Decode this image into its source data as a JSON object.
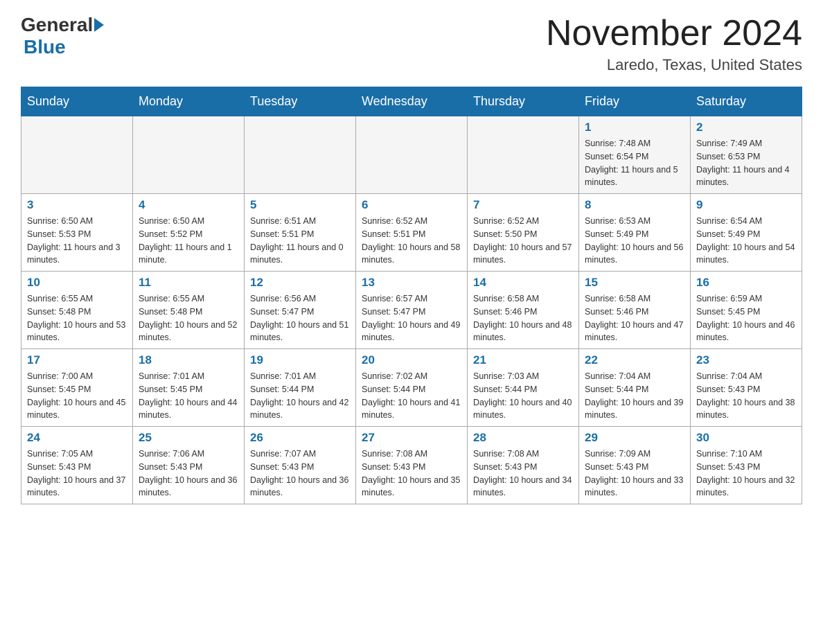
{
  "header": {
    "logo_general": "General",
    "logo_blue": "Blue",
    "month_title": "November 2024",
    "location": "Laredo, Texas, United States"
  },
  "weekdays": [
    "Sunday",
    "Monday",
    "Tuesday",
    "Wednesday",
    "Thursday",
    "Friday",
    "Saturday"
  ],
  "rows": [
    [
      {
        "day": "",
        "info": ""
      },
      {
        "day": "",
        "info": ""
      },
      {
        "day": "",
        "info": ""
      },
      {
        "day": "",
        "info": ""
      },
      {
        "day": "",
        "info": ""
      },
      {
        "day": "1",
        "info": "Sunrise: 7:48 AM\nSunset: 6:54 PM\nDaylight: 11 hours and 5 minutes."
      },
      {
        "day": "2",
        "info": "Sunrise: 7:49 AM\nSunset: 6:53 PM\nDaylight: 11 hours and 4 minutes."
      }
    ],
    [
      {
        "day": "3",
        "info": "Sunrise: 6:50 AM\nSunset: 5:53 PM\nDaylight: 11 hours and 3 minutes."
      },
      {
        "day": "4",
        "info": "Sunrise: 6:50 AM\nSunset: 5:52 PM\nDaylight: 11 hours and 1 minute."
      },
      {
        "day": "5",
        "info": "Sunrise: 6:51 AM\nSunset: 5:51 PM\nDaylight: 11 hours and 0 minutes."
      },
      {
        "day": "6",
        "info": "Sunrise: 6:52 AM\nSunset: 5:51 PM\nDaylight: 10 hours and 58 minutes."
      },
      {
        "day": "7",
        "info": "Sunrise: 6:52 AM\nSunset: 5:50 PM\nDaylight: 10 hours and 57 minutes."
      },
      {
        "day": "8",
        "info": "Sunrise: 6:53 AM\nSunset: 5:49 PM\nDaylight: 10 hours and 56 minutes."
      },
      {
        "day": "9",
        "info": "Sunrise: 6:54 AM\nSunset: 5:49 PM\nDaylight: 10 hours and 54 minutes."
      }
    ],
    [
      {
        "day": "10",
        "info": "Sunrise: 6:55 AM\nSunset: 5:48 PM\nDaylight: 10 hours and 53 minutes."
      },
      {
        "day": "11",
        "info": "Sunrise: 6:55 AM\nSunset: 5:48 PM\nDaylight: 10 hours and 52 minutes."
      },
      {
        "day": "12",
        "info": "Sunrise: 6:56 AM\nSunset: 5:47 PM\nDaylight: 10 hours and 51 minutes."
      },
      {
        "day": "13",
        "info": "Sunrise: 6:57 AM\nSunset: 5:47 PM\nDaylight: 10 hours and 49 minutes."
      },
      {
        "day": "14",
        "info": "Sunrise: 6:58 AM\nSunset: 5:46 PM\nDaylight: 10 hours and 48 minutes."
      },
      {
        "day": "15",
        "info": "Sunrise: 6:58 AM\nSunset: 5:46 PM\nDaylight: 10 hours and 47 minutes."
      },
      {
        "day": "16",
        "info": "Sunrise: 6:59 AM\nSunset: 5:45 PM\nDaylight: 10 hours and 46 minutes."
      }
    ],
    [
      {
        "day": "17",
        "info": "Sunrise: 7:00 AM\nSunset: 5:45 PM\nDaylight: 10 hours and 45 minutes."
      },
      {
        "day": "18",
        "info": "Sunrise: 7:01 AM\nSunset: 5:45 PM\nDaylight: 10 hours and 44 minutes."
      },
      {
        "day": "19",
        "info": "Sunrise: 7:01 AM\nSunset: 5:44 PM\nDaylight: 10 hours and 42 minutes."
      },
      {
        "day": "20",
        "info": "Sunrise: 7:02 AM\nSunset: 5:44 PM\nDaylight: 10 hours and 41 minutes."
      },
      {
        "day": "21",
        "info": "Sunrise: 7:03 AM\nSunset: 5:44 PM\nDaylight: 10 hours and 40 minutes."
      },
      {
        "day": "22",
        "info": "Sunrise: 7:04 AM\nSunset: 5:44 PM\nDaylight: 10 hours and 39 minutes."
      },
      {
        "day": "23",
        "info": "Sunrise: 7:04 AM\nSunset: 5:43 PM\nDaylight: 10 hours and 38 minutes."
      }
    ],
    [
      {
        "day": "24",
        "info": "Sunrise: 7:05 AM\nSunset: 5:43 PM\nDaylight: 10 hours and 37 minutes."
      },
      {
        "day": "25",
        "info": "Sunrise: 7:06 AM\nSunset: 5:43 PM\nDaylight: 10 hours and 36 minutes."
      },
      {
        "day": "26",
        "info": "Sunrise: 7:07 AM\nSunset: 5:43 PM\nDaylight: 10 hours and 36 minutes."
      },
      {
        "day": "27",
        "info": "Sunrise: 7:08 AM\nSunset: 5:43 PM\nDaylight: 10 hours and 35 minutes."
      },
      {
        "day": "28",
        "info": "Sunrise: 7:08 AM\nSunset: 5:43 PM\nDaylight: 10 hours and 34 minutes."
      },
      {
        "day": "29",
        "info": "Sunrise: 7:09 AM\nSunset: 5:43 PM\nDaylight: 10 hours and 33 minutes."
      },
      {
        "day": "30",
        "info": "Sunrise: 7:10 AM\nSunset: 5:43 PM\nDaylight: 10 hours and 32 minutes."
      }
    ]
  ]
}
